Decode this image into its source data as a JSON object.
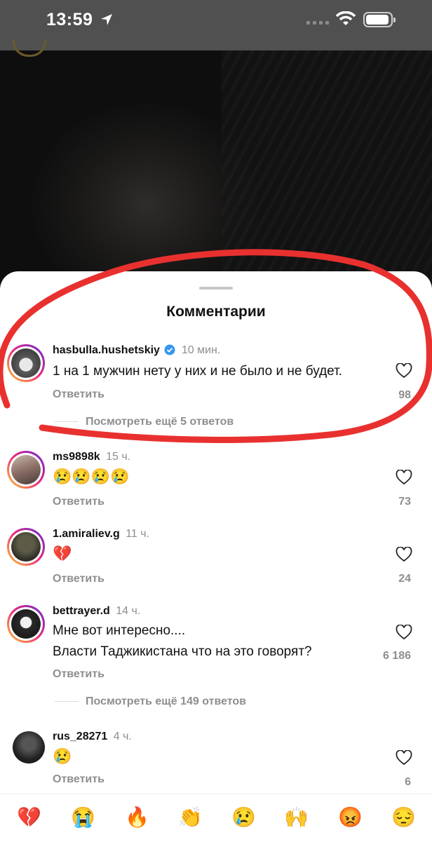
{
  "status_bar": {
    "time": "13:59"
  },
  "sheet": {
    "title": "Комментарии"
  },
  "comments": [
    {
      "username": "hasbulla.hushetskiy",
      "verified": true,
      "time": "10 мин.",
      "text": "1 на 1 мужчин нету у них и не было и не будет.",
      "reply_label": "Ответить",
      "likes": "98",
      "view_more": "Посмотреть ещё 5 ответов"
    },
    {
      "username": "ms9898k",
      "time": "15 ч.",
      "text": "😢😢😢😢",
      "reply_label": "Ответить",
      "likes": "73"
    },
    {
      "username": "1.amiraliev.g",
      "time": "11 ч.",
      "text": "💔",
      "reply_label": "Ответить",
      "likes": "24"
    },
    {
      "username": "bettrayer.d",
      "time": "14 ч.",
      "text_line1": "Мне вот интересно....",
      "text_line2": "Власти Таджикистана что на это говорят?",
      "reply_label": "Ответить",
      "likes": "6 186",
      "view_more": "Посмотреть ещё 149 ответов"
    },
    {
      "username": "rus_28271",
      "time": "4 ч.",
      "text": "😢",
      "reply_label": "Ответить",
      "likes": "6"
    }
  ],
  "emoji_bar": [
    "💔",
    "😭",
    "🔥",
    "👏",
    "😢",
    "🙌",
    "😡",
    "😔"
  ],
  "colors": {
    "annotation": "#e8312f",
    "verified": "#3897f0"
  }
}
